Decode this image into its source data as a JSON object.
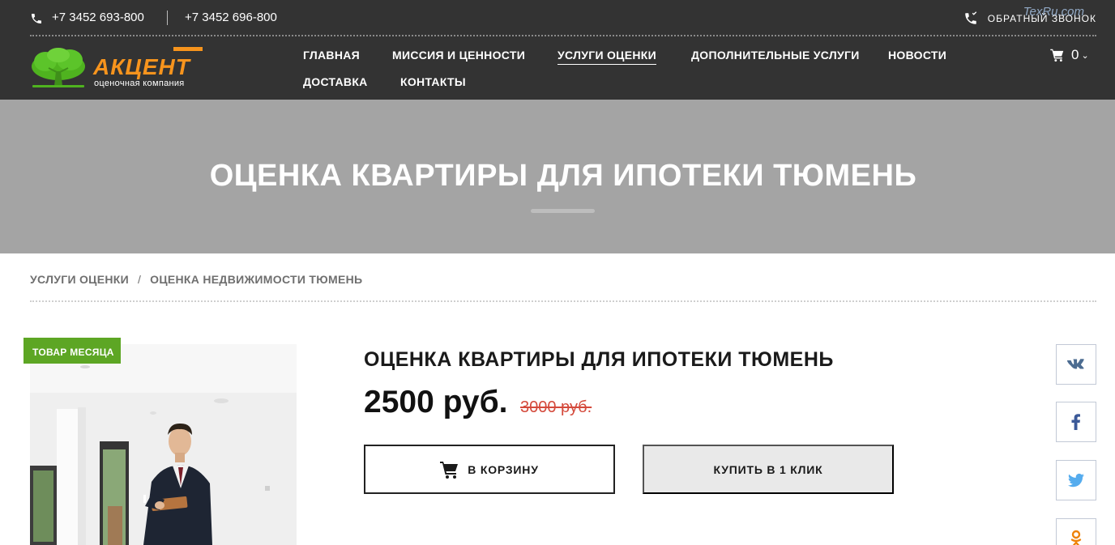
{
  "header": {
    "phone_1": "+7 3452 693-800",
    "phone_2": "+7 3452 696-800",
    "callback_label": "ОБРАТНЫЙ ЗВОНОК",
    "watermark": "TexRu.com",
    "logo_text": "АКЦЕНТ",
    "logo_subtitle": "оценочная компания",
    "nav": [
      {
        "label": "ГЛАВНАЯ",
        "active": false
      },
      {
        "label": "МИССИЯ И ЦЕННОСТИ",
        "active": false
      },
      {
        "label": "УСЛУГИ ОЦЕНКИ",
        "active": true
      },
      {
        "label": "ДОПОЛНИТЕЛЬНЫЕ УСЛУГИ",
        "active": false
      },
      {
        "label": "НОВОСТИ",
        "active": false
      },
      {
        "label": "ДОСТАВКА",
        "active": false
      },
      {
        "label": "КОНТАКТЫ",
        "active": false
      }
    ],
    "cart_count": "0"
  },
  "banner": {
    "title": "ОЦЕНКА КВАРТИРЫ ДЛЯ ИПОТЕКИ ТЮМЕНЬ"
  },
  "breadcrumb": {
    "items": [
      "УСЛУГИ ОЦЕНКИ",
      "ОЦЕНКА НЕДВИЖИМОСТИ ТЮМЕНЬ"
    ],
    "separator": "/"
  },
  "product": {
    "badge": "ТОВАР МЕСЯЦА",
    "title": "ОЦЕНКА КВАРТИРЫ ДЛЯ ИПОТЕКИ ТЮМЕНЬ",
    "price": "2500 руб.",
    "old_price": "3000 руб.",
    "add_to_cart_label": "В КОРЗИНУ",
    "buy_one_click_label": "КУПИТЬ В 1 КЛИК"
  },
  "social": [
    {
      "icon": "vk-icon",
      "color": "#4c6c91"
    },
    {
      "icon": "facebook-icon",
      "color": "#3b5998"
    },
    {
      "icon": "twitter-icon",
      "color": "#55acee"
    },
    {
      "icon": "odnoklassniki-icon",
      "color": "#ee8208"
    }
  ],
  "colors": {
    "header_bg": "#333333",
    "accent_orange": "#f7941d",
    "badge_green": "#5da624",
    "banner_bg": "#a4a4a4",
    "old_price": "#d44a3c"
  }
}
